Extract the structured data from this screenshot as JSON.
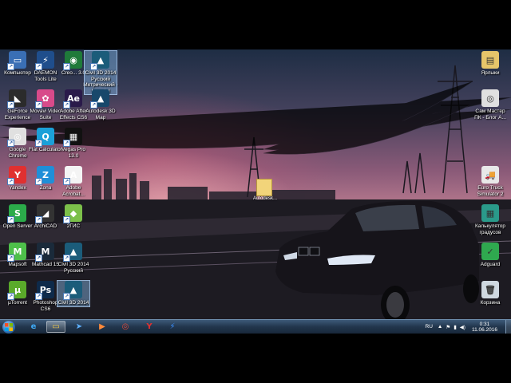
{
  "desktop": {
    "icons_left": [
      {
        "label": "Компьютер",
        "icon": "computer-icon",
        "color": "#3a6fb5",
        "glyph": "▭"
      },
      {
        "label": "DAEMON Tools Lite",
        "icon": "daemon-tools-icon",
        "color": "#1f4e8c",
        "glyph": "⚡"
      },
      {
        "label": "Creo... 3.0",
        "icon": "creo-icon",
        "color": "#1f7a3a",
        "glyph": "◉"
      },
      {
        "label": "Civil 3D 2014 Русский Метрический - Imperial",
        "icon": "civil3d-icon",
        "color": "#1b5c7a",
        "glyph": "▲"
      },
      {
        "label": "GeForce Experience",
        "icon": "geforce-icon",
        "color": "#2b2b2b",
        "glyph": "◣"
      },
      {
        "label": "Movavi Video Suite",
        "icon": "movavi-icon",
        "color": "#d84a8a",
        "glyph": "✿"
      },
      {
        "label": "Adobe After Effects CS6",
        "icon": "after-effects-icon",
        "color": "#2a1a4a",
        "glyph": "Ae"
      },
      {
        "label": "Autodesk 3D Map",
        "icon": "autodesk-map-icon",
        "color": "#18486b",
        "glyph": "▲"
      },
      {
        "label": "Google Chrome",
        "icon": "chrome-icon",
        "color": "#e0e0e0",
        "glyph": "◎"
      },
      {
        "label": "Flat Calculator",
        "icon": "calculator-icon",
        "color": "#1ba0d8",
        "glyph": "Q"
      },
      {
        "label": "Vegas Pro 13.0",
        "icon": "vegas-icon",
        "color": "#111111",
        "glyph": "▦"
      },
      {
        "label": "Yandex",
        "icon": "yandex-icon",
        "color": "#e03030",
        "glyph": "Y"
      },
      {
        "label": "Zona",
        "icon": "zona-icon",
        "color": "#1f8fd8",
        "glyph": "Z"
      },
      {
        "label": "Adobe Acrobat...",
        "icon": "acrobat-icon",
        "color": "#f4f4f4",
        "glyph": "A"
      },
      {
        "label": "Open Server",
        "icon": "open-server-icon",
        "color": "#2bab4a",
        "glyph": "S"
      },
      {
        "label": "ArchiCAD",
        "icon": "archicad-icon",
        "color": "#333333",
        "glyph": "◢"
      },
      {
        "label": "2ГИС",
        "icon": "2gis-icon",
        "color": "#7cc04a",
        "glyph": "◆"
      },
      {
        "label": "Mapsoft",
        "icon": "mapsoft-icon",
        "color": "#4ec04a",
        "glyph": "M"
      },
      {
        "label": "Mathcad 15",
        "icon": "mathcad-icon",
        "color": "#1a2a3a",
        "glyph": "M"
      },
      {
        "label": "Civil 3D 2014 Русский",
        "icon": "civil3d-ru-icon",
        "color": "#1b5c7a",
        "glyph": "▲"
      },
      {
        "label": "µTorrent",
        "icon": "utorrent-icon",
        "color": "#5aaa2a",
        "glyph": "µ"
      },
      {
        "label": "Photoshop CS6",
        "icon": "photoshop-icon",
        "color": "#0e2a4a",
        "glyph": "Ps"
      },
      {
        "label": "Civil 3D 2014",
        "icon": "civil3d-2014-icon",
        "color": "#1b5c7a",
        "glyph": "▲"
      }
    ],
    "icons_right": [
      {
        "label": "Ярлыки",
        "icon": "shortcuts-folder-icon",
        "color": "#e6c56a",
        "glyph": "▤"
      },
      {
        "label": "Сам Мастер ПК - Блог А...",
        "icon": "chrome-site-icon",
        "color": "#e0e0e0",
        "glyph": "◎"
      },
      {
        "label": "Euro Truck Simulator 2",
        "icon": "euro-truck-icon",
        "color": "#e8e8e8",
        "glyph": "🚚"
      },
      {
        "label": "Калькулятор градусов",
        "icon": "degrees-calculator-icon",
        "color": "#2a9a8a",
        "glyph": "▦"
      },
      {
        "label": "Adguard",
        "icon": "adguard-icon",
        "color": "#2fa84f",
        "glyph": "✓"
      },
      {
        "label": "Корзина",
        "icon": "recycle-bin-icon",
        "color": "#cfd8e0",
        "glyph": "🗑"
      }
    ],
    "center_file": {
      "label": "Autodesk...",
      "icon": "file-icon"
    }
  },
  "taskbar": {
    "items": [
      {
        "name": "ie-icon",
        "glyph": "e",
        "color": "#3fa9f5"
      },
      {
        "name": "explorer-icon",
        "glyph": "▭",
        "color": "#f0c94a"
      },
      {
        "name": "cursor-app-icon",
        "glyph": "➤",
        "color": "#5db0ff"
      },
      {
        "name": "media-player-icon",
        "glyph": "▶",
        "color": "#ff8a3a"
      },
      {
        "name": "chrome-icon",
        "glyph": "◎",
        "color": "#e24a3a"
      },
      {
        "name": "yandex-icon",
        "glyph": "Y",
        "color": "#e03030"
      },
      {
        "name": "daemon-tools-icon",
        "glyph": "⚡",
        "color": "#3a8fff"
      }
    ],
    "tray": {
      "language": "RU",
      "time": "0:31",
      "date": "11.06.2016"
    }
  }
}
